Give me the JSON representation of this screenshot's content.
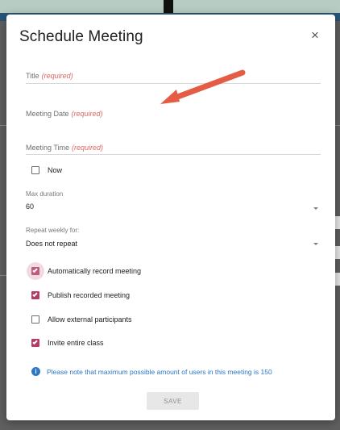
{
  "modal": {
    "title": "Schedule Meeting",
    "close_icon": "close-icon"
  },
  "fields": {
    "title": {
      "label": "Title",
      "required": "(required)"
    },
    "meeting_date": {
      "label": "Meeting Date",
      "required": "(required)"
    },
    "meeting_time": {
      "label": "Meeting Time",
      "required": "(required)"
    }
  },
  "checkboxes": {
    "now": {
      "label": "Now",
      "checked": false
    },
    "automatically_record_meeting": {
      "label": "Automatically record meeting",
      "checked": true
    },
    "publish_recorded_meeting": {
      "label": "Publish recorded meeting",
      "checked": true
    },
    "allow_external_participants": {
      "label": "Allow external participants",
      "checked": false
    },
    "invite_entire_class": {
      "label": "Invite entire class",
      "checked": true
    }
  },
  "selects": {
    "max_duration": {
      "label": "Max duration",
      "value": "60"
    },
    "repeat_weekly": {
      "label": "Repeat weekly for:",
      "value": "Does not repeat"
    }
  },
  "note": {
    "icon": "info-icon",
    "text": "Please note that maximum possible amount of users in this meeting is 150"
  },
  "actions": {
    "save_label": "SAVE"
  },
  "colors": {
    "accent": "#b73a64",
    "required": "#e06666",
    "info": "#2b77c5",
    "annotation_arrow": "#e45c43"
  }
}
